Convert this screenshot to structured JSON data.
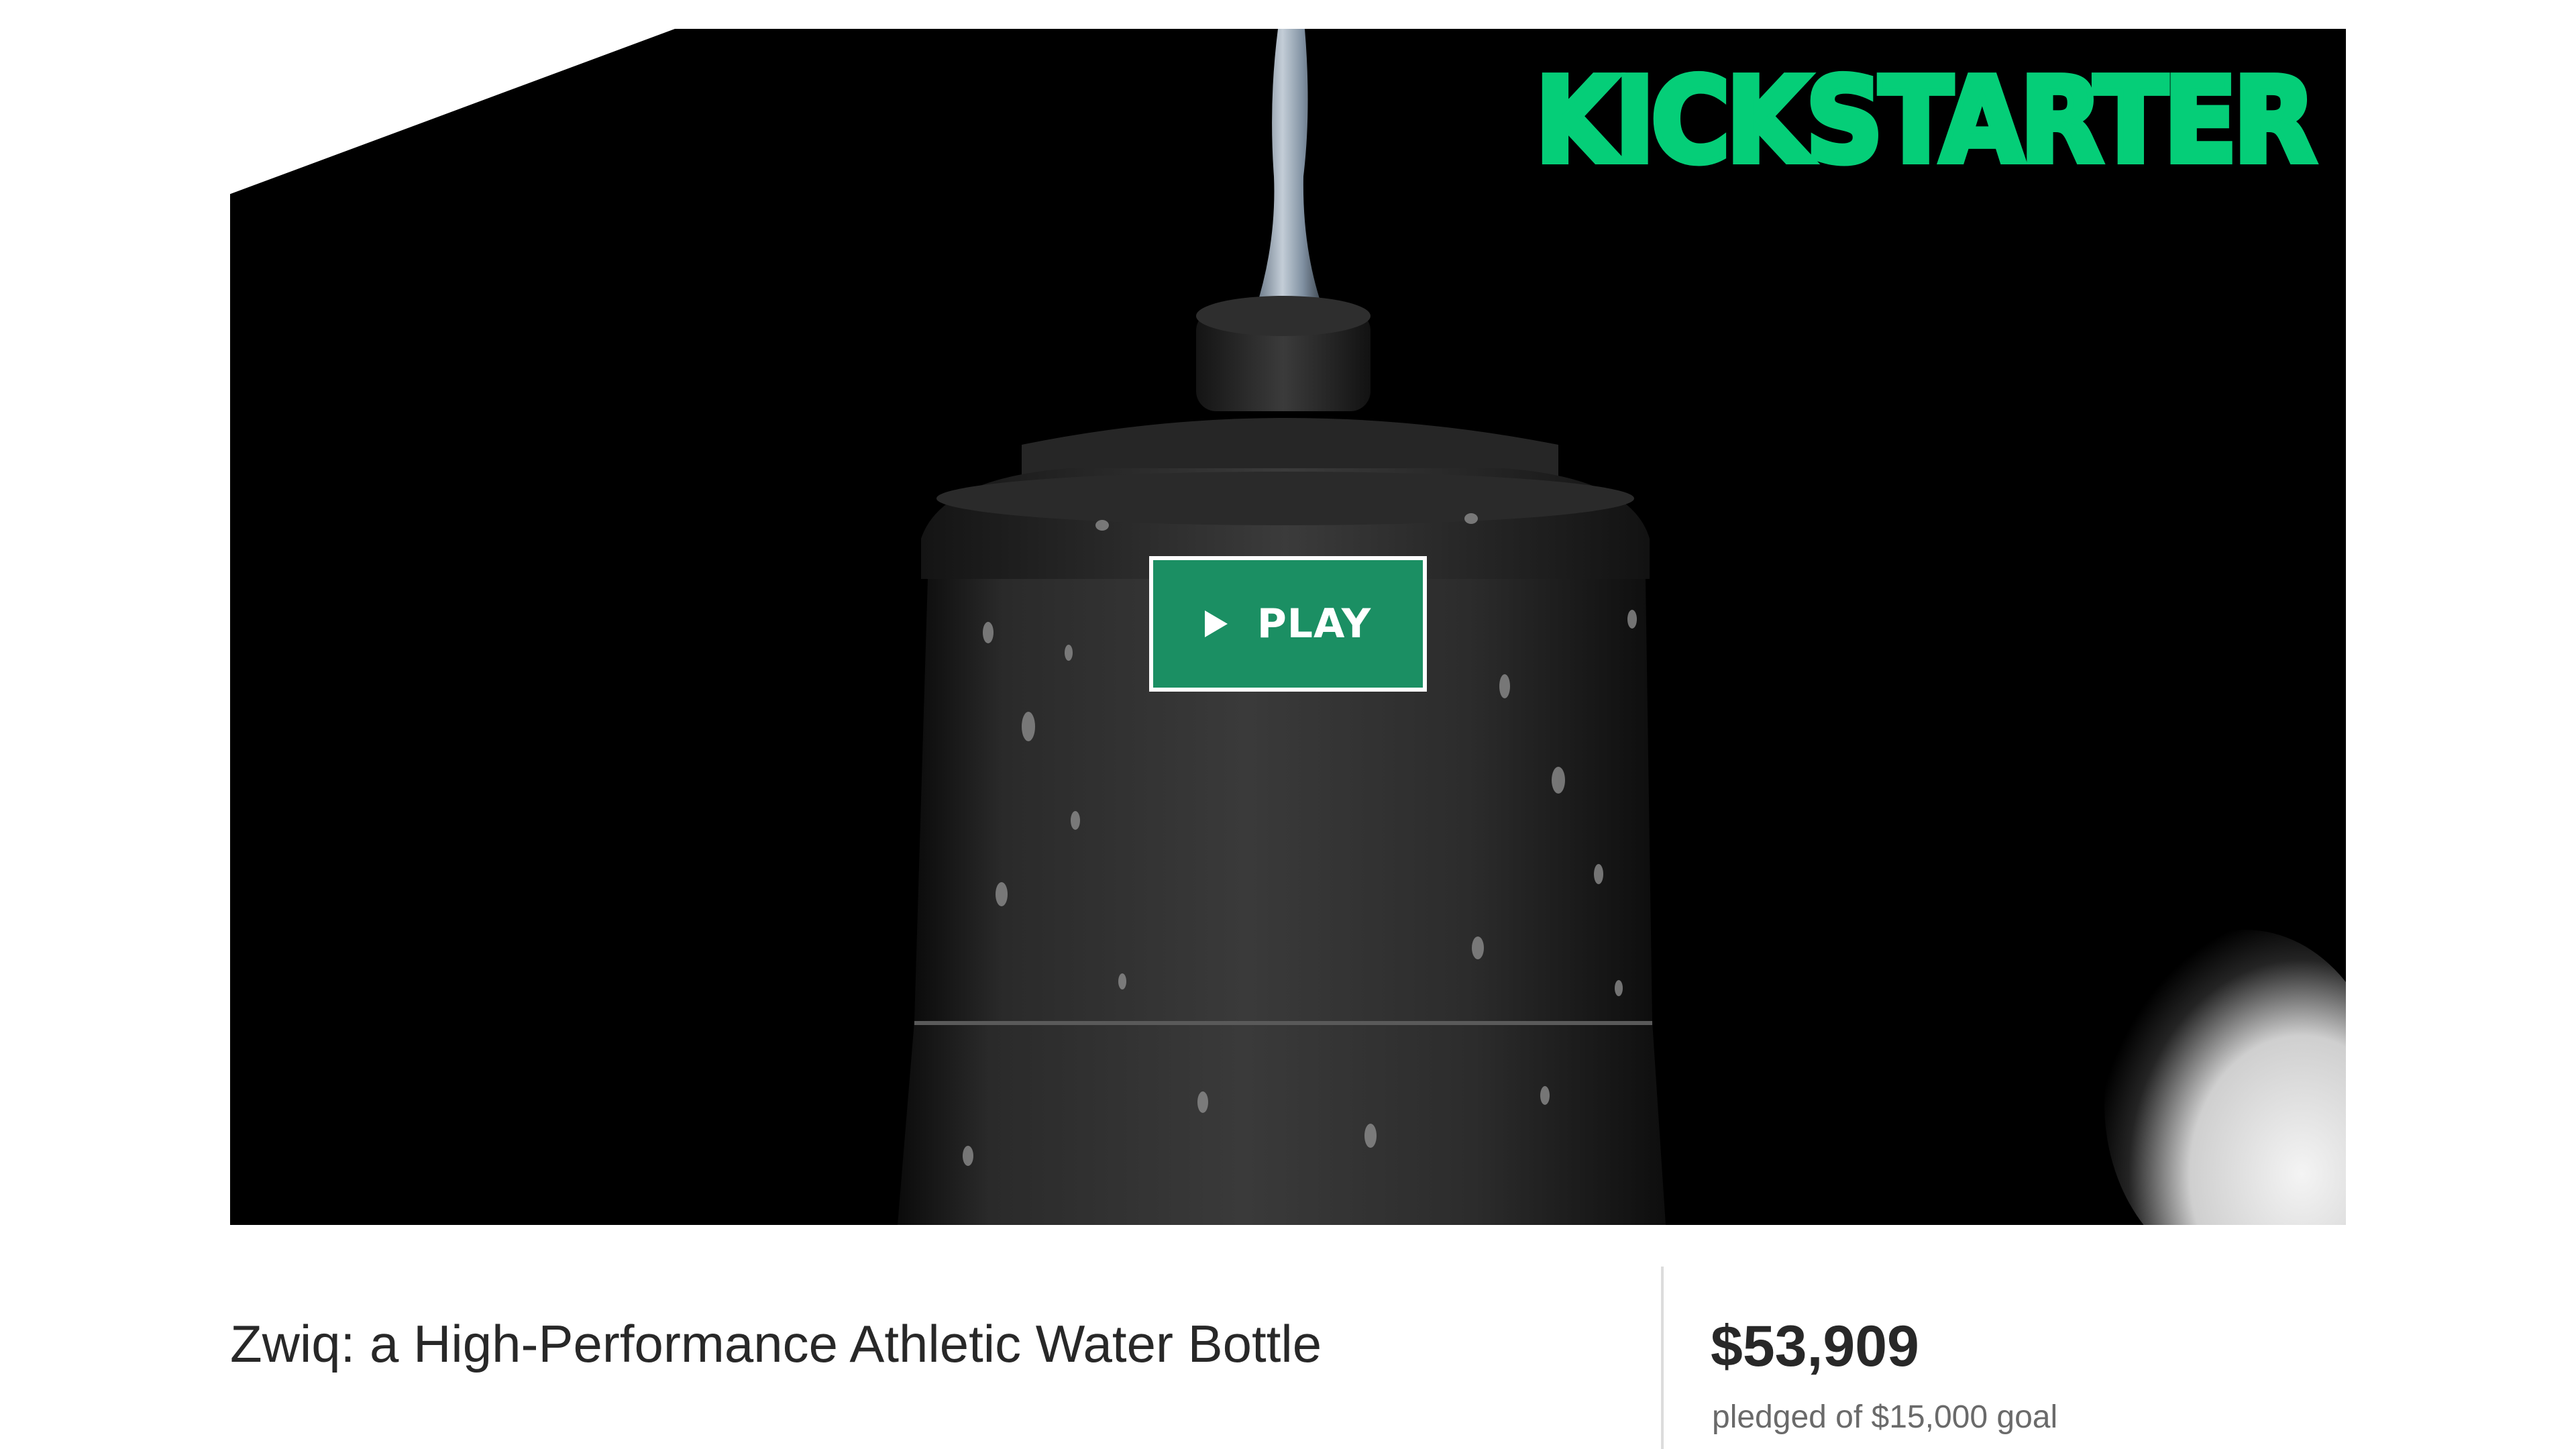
{
  "video": {
    "logo_text": "KICKSTARTER",
    "play_label": "PLAY",
    "logo_color": "#05ce78",
    "play_color": "#1b8f63"
  },
  "project": {
    "title": "Zwiq: a High-Performance Athletic Water Bottle",
    "pledged_amount": "$53,909",
    "goal_text": "pledged of $15,000 goal"
  },
  "icons": {
    "play": "play-icon"
  }
}
